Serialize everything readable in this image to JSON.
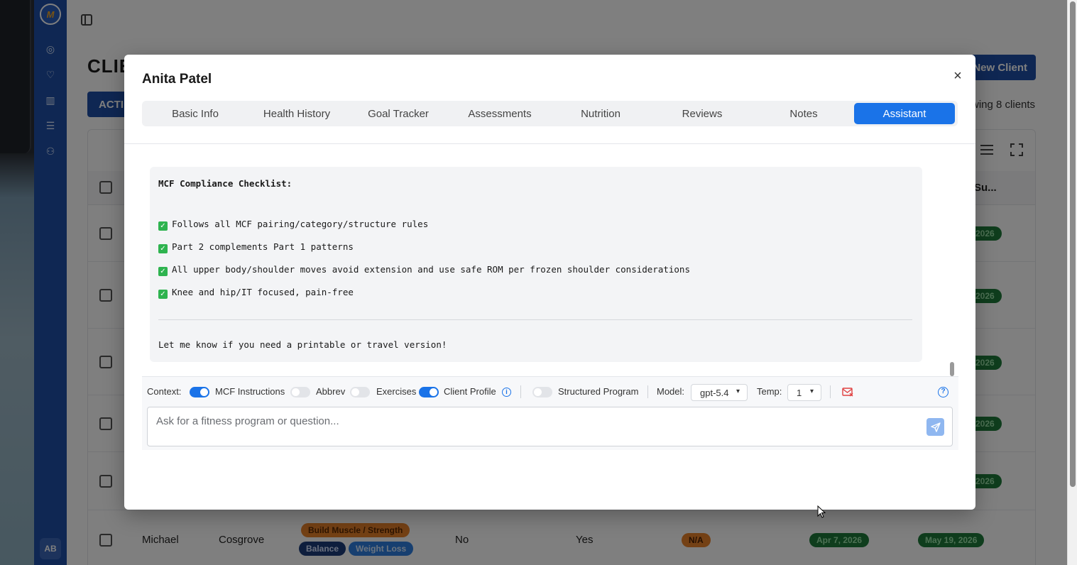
{
  "background_app": {
    "page_title": "CLIE",
    "active_tab": "ACTI",
    "new_client_button": "New Client",
    "showing_text": "wing 8 clients",
    "column_header_partial": "Su...",
    "avatar_initials": "AB",
    "last_row": {
      "first_name": "Michael",
      "last_name": "Cosgrove",
      "tags": [
        "Build Muscle / Strength",
        "Balance",
        "Weight Loss"
      ],
      "col_a": "No",
      "col_b": "Yes",
      "status": "N/A",
      "date_1": "Apr 7, 2026",
      "date_2": "May 19, 2026"
    },
    "row_pill_text": "2026"
  },
  "modal": {
    "title": "Anita Patel",
    "close_label": "×",
    "tabs": [
      {
        "label": "Basic Info"
      },
      {
        "label": "Health History"
      },
      {
        "label": "Goal Tracker"
      },
      {
        "label": "Assessments"
      },
      {
        "label": "Nutrition"
      },
      {
        "label": "Reviews"
      },
      {
        "label": "Notes"
      },
      {
        "label": "Assistant"
      }
    ],
    "active_tab": "Assistant"
  },
  "chat": {
    "heading": "MCF Compliance Checklist:",
    "checklist": [
      "Follows all MCF pairing/category/structure rules",
      "Part 2 complements Part 1 patterns",
      "All upper body/shoulder moves avoid extension and use safe ROM per frozen shoulder considerations",
      "Knee and hip/IT focused, pain-free"
    ],
    "footer": "Let me know if you need a printable or travel version!"
  },
  "context_bar": {
    "context_label": "Context:",
    "toggles": [
      {
        "label": "MCF Instructions",
        "on": true
      },
      {
        "label": "Abbrev",
        "on": false
      },
      {
        "label": "Exercises",
        "on": false
      },
      {
        "label": "Client Profile",
        "on": true
      },
      {
        "label": "Structured Program",
        "on": false
      }
    ],
    "model_label": "Model:",
    "model_value": "gpt-5.4",
    "temp_label": "Temp:",
    "temp_value": "1",
    "input_placeholder": "Ask for a fitness program or question..."
  },
  "colors": {
    "primary": "#1a73e8",
    "brand_navy": "#1e4fa6",
    "check_green": "#2eb34f"
  }
}
